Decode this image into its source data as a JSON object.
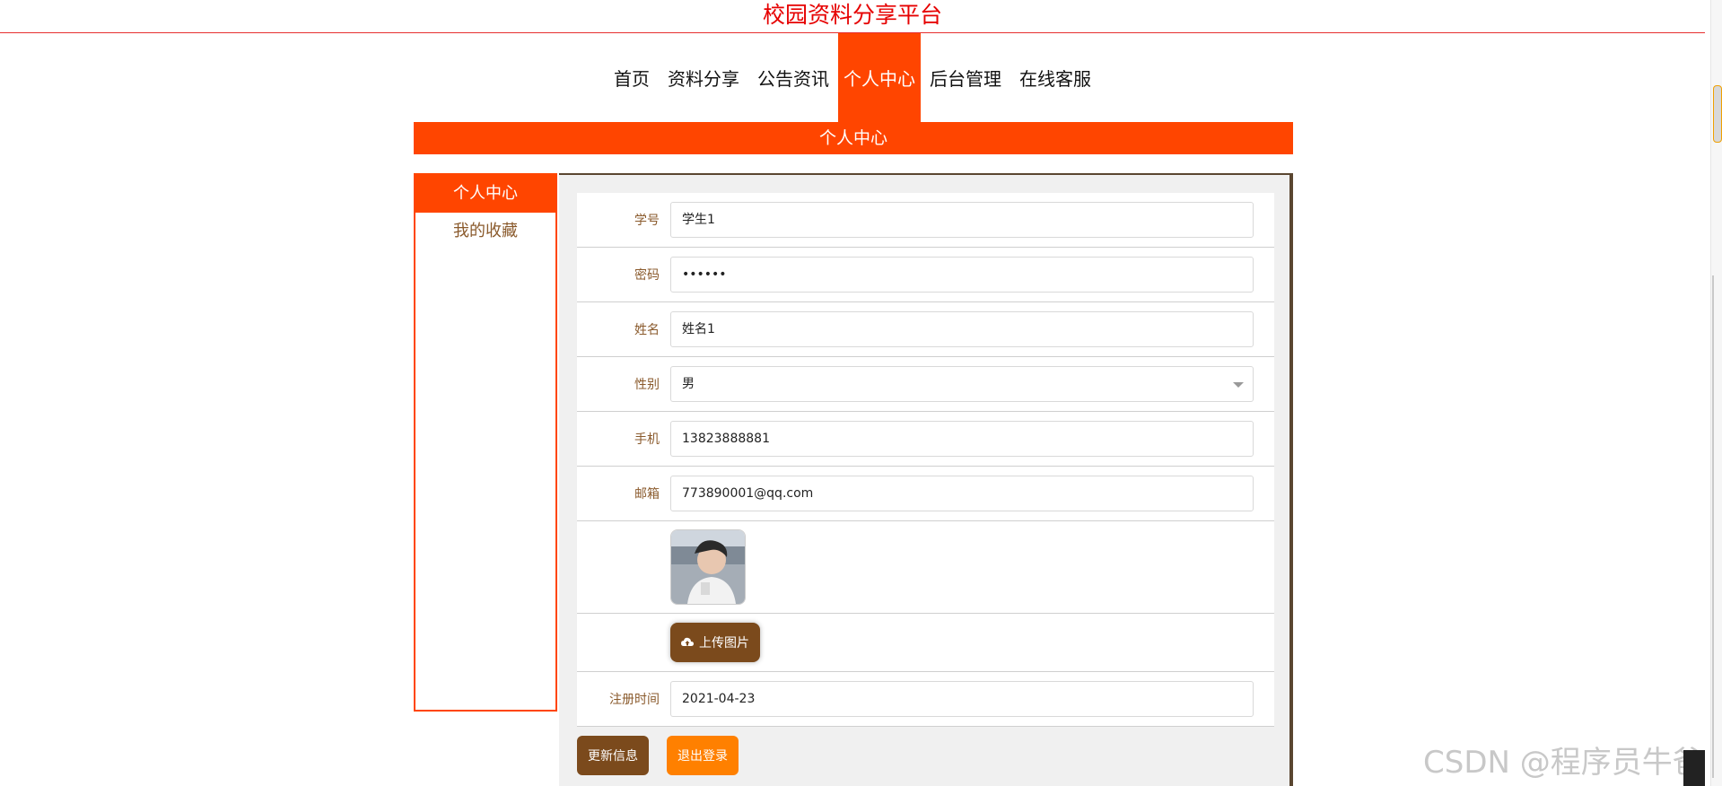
{
  "site": {
    "title": "校园资料分享平台"
  },
  "nav": [
    {
      "label": "首页",
      "active": false
    },
    {
      "label": "资料分享",
      "active": false
    },
    {
      "label": "公告资讯",
      "active": false
    },
    {
      "label": "个人中心",
      "active": true
    },
    {
      "label": "后台管理",
      "active": false
    },
    {
      "label": "在线客服",
      "active": false
    }
  ],
  "section": {
    "title": "个人中心"
  },
  "sidebar": {
    "items": [
      {
        "label": "个人中心",
        "active": true
      },
      {
        "label": "我的收藏",
        "active": false
      }
    ]
  },
  "form": {
    "student_id_label": "学号",
    "student_id_value": "学生1",
    "password_label": "密码",
    "password_value": "••••••",
    "name_label": "姓名",
    "name_value": "姓名1",
    "gender_label": "性别",
    "gender_value": "男",
    "phone_label": "手机",
    "phone_value": "13823888881",
    "email_label": "邮箱",
    "email_value": "773890001@qq.com",
    "upload_label": "上传图片",
    "regtime_label": "注册时间",
    "regtime_value": "2021-04-23"
  },
  "actions": {
    "update_label": "更新信息",
    "logout_label": "退出登录"
  },
  "watermark": "CSDN @程序员牛爸",
  "colors": {
    "accent": "#ff4500",
    "brown": "#7b4a1c",
    "orange": "#ff8000",
    "title_red": "#e60000"
  }
}
